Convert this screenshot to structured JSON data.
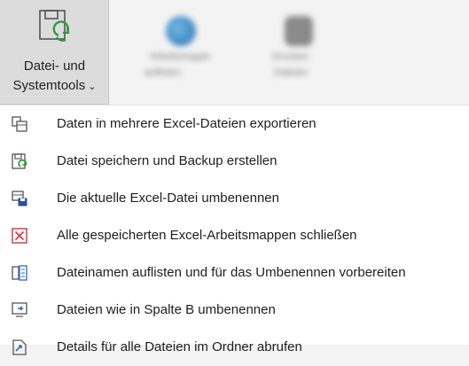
{
  "ribbon": {
    "main_button": {
      "label_line1": "Datei- und",
      "label_line2": "Systemtools",
      "chevron": "⌄",
      "icon": "save-refresh-icon"
    },
    "blurred_buttons": [
      {
        "line1": "Arbeitsmappe",
        "line2": "auflisten",
        "icon": "globe-icon"
      },
      {
        "line1": "Drucken",
        "line2": "Dateien",
        "icon": "print-icon"
      }
    ]
  },
  "menu": {
    "items": [
      {
        "label": "Daten in mehrere Excel-Dateien exportieren",
        "icon": "copy-export-icon"
      },
      {
        "label": "Datei speichern und Backup erstellen",
        "icon": "save-backup-icon"
      },
      {
        "label": "Die aktuelle Excel-Datei umbenennen",
        "icon": "rename-file-icon"
      },
      {
        "label": "Alle gespeicherten Excel-Arbeitsmappen schließen",
        "icon": "close-all-icon"
      },
      {
        "label": "Dateinamen auflisten und für das Umbenennen vorbereiten",
        "icon": "list-files-icon"
      },
      {
        "label": "Dateien wie in Spalte B umbenennen",
        "icon": "rename-column-icon"
      },
      {
        "label": "Details für alle Dateien im Ordner abrufen",
        "icon": "file-details-icon"
      }
    ]
  },
  "colors": {
    "accent_green": "#2e9b3e",
    "accent_red": "#d9323a",
    "accent_blue": "#2b6cc4",
    "icon_gray": "#555555"
  }
}
